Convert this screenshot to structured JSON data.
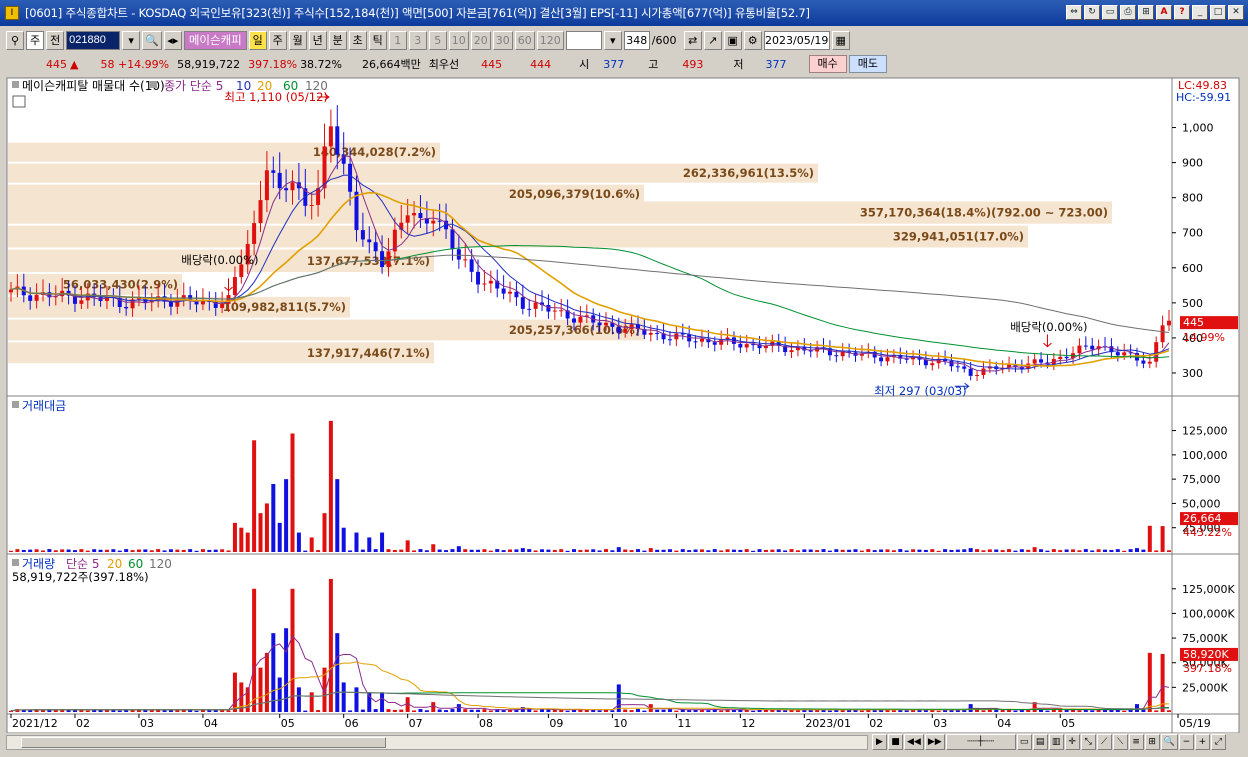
{
  "window": {
    "title": "[0601] 주식종합차트 - KOSDAQ 외국인보유[323(천)] 주식수[152,184(천)] 액면[500] 자본금[761(억)] 결산[3월] EPS[-11] 시가총액[677(억)] 유통비율[52.7]",
    "buttons": [
      "link-icon",
      "refresh-icon",
      "window-icon",
      "print-icon",
      "pin-icon",
      "font-icon",
      "help-icon",
      "minimize-icon",
      "maximize-icon",
      "close-icon"
    ]
  },
  "toolbar": {
    "market": "주",
    "prev_label": "전",
    "code": "021880",
    "stock_name": "메이슨캐피",
    "periods": [
      "일",
      "주",
      "월",
      "년",
      "분",
      "초",
      "틱"
    ],
    "active_period": "일",
    "intervals": [
      "1",
      "3",
      "5",
      "10",
      "20",
      "30",
      "60",
      "120"
    ],
    "count": "348",
    "count_max": "/600",
    "date": "2023/05/19"
  },
  "quote": {
    "price": "445",
    "change": "58 +14.99%",
    "volume": "58,919,722",
    "volume_ratio": "397.18%",
    "turnover": "38.72%",
    "amount": "26,664백만",
    "best_label": "최우선",
    "best_ask": "445",
    "best_bid": "444",
    "open_label": "시",
    "open": "377",
    "high_label": "고",
    "high": "493",
    "low_label": "저",
    "low": "377",
    "buy_label": "매수",
    "sell_label": "매도"
  },
  "chart_data": [
    {
      "type": "line",
      "pane": "price",
      "title": "메이슨캐피탈 매물대 수(10)",
      "legend": [
        "종가 단순 5",
        "10",
        "20",
        "60",
        "120"
      ],
      "legend_colors": [
        "#8b2d8b",
        "#2030c0",
        "#e0a000",
        "#009030",
        "#707070"
      ],
      "y_ticks": [
        "1,000",
        "900",
        "800",
        "700",
        "600",
        "500",
        "400",
        "300"
      ],
      "ylim": [
        240,
        1090
      ],
      "x_ticks": [
        "2021/12",
        "02",
        "03",
        "04",
        "05",
        "06",
        "07",
        "08",
        "09",
        "10",
        "11",
        "12",
        "2023/01",
        "02",
        "03",
        "04",
        "05",
        "05/19"
      ],
      "lc_label": "LC:49.83",
      "hc_label": "HC:-59.91",
      "current_price_label": "445",
      "current_change_label": "14.99%",
      "annotations": {
        "high": "최고 1,110 (05/12)",
        "low": "최저 297 (03/03)",
        "dividend1": "배당락(0.00%)",
        "dividend2": "배당락(0.00%)"
      },
      "volume_profile": [
        {
          "label": "140,344,028(7.2%)",
          "price_from": 900,
          "price_to": 960
        },
        {
          "label": "262,336,961(13.5%)",
          "price_from": 840,
          "price_to": 900
        },
        {
          "label": "205,096,379(10.6%)",
          "price_from": 780,
          "price_to": 840
        },
        {
          "label": "357,170,364(18.4%)(792.00 ~ 723.00)",
          "price_from": 723,
          "price_to": 792
        },
        {
          "label": "329,941,051(17.0%)",
          "price_from": 655,
          "price_to": 723
        },
        {
          "label": "137,677,533(7.1%)",
          "price_from": 585,
          "price_to": 655
        },
        {
          "label": "56,033,430(2.9%)",
          "price_from": 520,
          "price_to": 585
        },
        {
          "label": "109,982,811(5.7%)",
          "price_from": 455,
          "price_to": 520
        },
        {
          "label": "205,257,366(10.6%)",
          "price_from": 390,
          "price_to": 455
        },
        {
          "label": "137,917,446(7.1%)",
          "price_from": 325,
          "price_to": 390
        }
      ],
      "close_points": [
        [
          0,
          530
        ],
        [
          6,
          520
        ],
        [
          12,
          515
        ],
        [
          18,
          500
        ],
        [
          24,
          510
        ],
        [
          30,
          500
        ],
        [
          34,
          505
        ],
        [
          36,
          620
        ],
        [
          38,
          720
        ],
        [
          40,
          900
        ],
        [
          42,
          800
        ],
        [
          44,
          860
        ],
        [
          46,
          780
        ],
        [
          48,
          820
        ],
        [
          50,
          1000
        ],
        [
          52,
          900
        ],
        [
          54,
          720
        ],
        [
          56,
          650
        ],
        [
          58,
          620
        ],
        [
          60,
          700
        ],
        [
          62,
          760
        ],
        [
          64,
          720
        ],
        [
          66,
          760
        ],
        [
          68,
          700
        ],
        [
          70,
          620
        ],
        [
          74,
          560
        ],
        [
          80,
          500
        ],
        [
          86,
          470
        ],
        [
          92,
          440
        ],
        [
          98,
          420
        ],
        [
          104,
          400
        ],
        [
          110,
          390
        ],
        [
          116,
          380
        ],
        [
          122,
          370
        ],
        [
          128,
          360
        ],
        [
          134,
          350
        ],
        [
          140,
          340
        ],
        [
          146,
          330
        ],
        [
          150,
          300
        ],
        [
          156,
          320
        ],
        [
          162,
          330
        ],
        [
          166,
          360
        ],
        [
          170,
          380
        ],
        [
          174,
          350
        ],
        [
          178,
          330
        ],
        [
          180,
          445
        ]
      ]
    },
    {
      "type": "bar",
      "pane": "amount",
      "title": "거래대금",
      "y_ticks": [
        "125,000",
        "100,000",
        "75,000",
        "50,000",
        "25,000"
      ],
      "ylim": [
        0,
        140000
      ],
      "current_label": "26,664",
      "current_ratio_label": "443.22%",
      "spikes": [
        [
          35,
          30000
        ],
        [
          36,
          25000
        ],
        [
          37,
          20000
        ],
        [
          38,
          115000
        ],
        [
          39,
          40000
        ],
        [
          40,
          50000
        ],
        [
          41,
          70000
        ],
        [
          42,
          30000
        ],
        [
          43,
          75000
        ],
        [
          44,
          122000
        ],
        [
          45,
          20000
        ],
        [
          47,
          15000
        ],
        [
          49,
          40000
        ],
        [
          50,
          135000
        ],
        [
          51,
          75000
        ],
        [
          52,
          25000
        ],
        [
          54,
          20000
        ],
        [
          56,
          15000
        ],
        [
          58,
          20000
        ],
        [
          62,
          12000
        ],
        [
          66,
          8000
        ],
        [
          70,
          6000
        ],
        [
          80,
          4000
        ],
        [
          95,
          5000
        ],
        [
          100,
          4000
        ],
        [
          150,
          4000
        ],
        [
          160,
          5000
        ],
        [
          176,
          4000
        ],
        [
          178,
          27000
        ],
        [
          180,
          26664
        ]
      ]
    },
    {
      "type": "bar",
      "pane": "volume",
      "title": "거래량",
      "legend": [
        "단순 5",
        "20",
        "60",
        "120"
      ],
      "legend_colors": [
        "#8b2d8b",
        "#e0a000",
        "#009030",
        "#707070"
      ],
      "value_label": "58,919,722주(397.18%)",
      "y_ticks": [
        "125,000K",
        "100,000K",
        "75,000K",
        "50,000K",
        "25,000K"
      ],
      "ylim": [
        0,
        140000
      ],
      "current_label": "58,920K",
      "current_ratio_label": "397.18%",
      "spikes": [
        [
          35,
          40000
        ],
        [
          36,
          30000
        ],
        [
          37,
          25000
        ],
        [
          38,
          125000
        ],
        [
          39,
          45000
        ],
        [
          40,
          60000
        ],
        [
          41,
          80000
        ],
        [
          42,
          35000
        ],
        [
          43,
          85000
        ],
        [
          44,
          125000
        ],
        [
          45,
          25000
        ],
        [
          47,
          20000
        ],
        [
          49,
          45000
        ],
        [
          50,
          135000
        ],
        [
          51,
          80000
        ],
        [
          52,
          30000
        ],
        [
          54,
          25000
        ],
        [
          56,
          20000
        ],
        [
          58,
          20000
        ],
        [
          62,
          15000
        ],
        [
          66,
          10000
        ],
        [
          70,
          8000
        ],
        [
          80,
          5000
        ],
        [
          95,
          28000
        ],
        [
          100,
          8000
        ],
        [
          150,
          8000
        ],
        [
          160,
          10000
        ],
        [
          176,
          8000
        ],
        [
          178,
          60000
        ],
        [
          180,
          58920
        ]
      ]
    }
  ]
}
